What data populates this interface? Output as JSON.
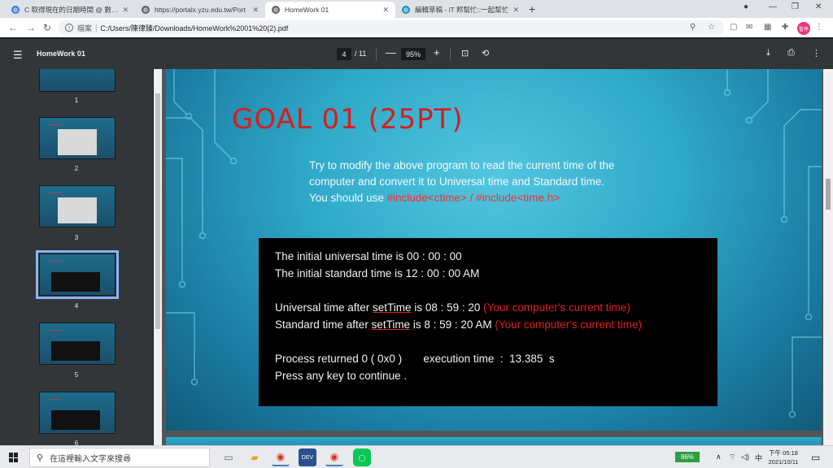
{
  "browser": {
    "tabs": [
      {
        "label": "C 取得現在的日期時間 @ 數位故",
        "fav_color": "#3b7dd8"
      },
      {
        "label": "https://portalx.yzu.edu.tw/Port",
        "fav_color": "#5f6368"
      },
      {
        "label": "HomeWork 01",
        "fav_color": "#5f6368"
      },
      {
        "label": "編輯草稿 - iT 邦幫忙::一起幫忙",
        "fav_color": "#1b8fc2"
      }
    ],
    "new_tab": "+",
    "window_controls": {
      "dropdown": "●",
      "minimize": "—",
      "maximize": "❐",
      "close": "✕"
    },
    "address": {
      "scheme": "檔案",
      "separator": "|",
      "url": "C:/Users/陳律臻/Downloads/HomeWork%2001%20(2).pdf"
    },
    "profile_label": "暫停"
  },
  "pdf_toolbar": {
    "title": "HomeWork 01",
    "page_current": "4",
    "page_total": "/ 11",
    "zoom": "95%",
    "minus": "—",
    "plus": "+"
  },
  "thumbnails": [
    {
      "number": "1"
    },
    {
      "number": "2"
    },
    {
      "number": "3"
    },
    {
      "number": "4"
    },
    {
      "number": "5"
    },
    {
      "number": "6"
    }
  ],
  "slide": {
    "title": "GOAL 01 (25PT)",
    "body": "Try to modify the above program to read the current time of the computer and convert it to Universal time and Standard time.",
    "use_prefix": "You should use ",
    "use_includes": "#include<ctime> / #include<time.h>",
    "console": {
      "line1": "The initial universal time is 00 : 00 : 00",
      "line2": "The initial standard time is 12 : 00 : 00 AM",
      "line3_prefix": "Universal time after ",
      "line3_fn": "setTime",
      "line3_value": " is 08 : 59 : 20 ",
      "line3_note": "(Your computer's current time)",
      "line4_prefix": "Standard time after ",
      "line4_fn": "setTime",
      "line4_value": " is 8 : 59 : 20 AM ",
      "line4_note": "(Your computer's current time)",
      "line5": "Process returned 0 ( 0x0 )       execution time  :  13.385  s",
      "line6": "Press any key to continue ."
    }
  },
  "taskbar": {
    "search_placeholder": "在這裡輸入文字來搜尋",
    "battery": "86%",
    "ime": "中",
    "time": "下午 05:18",
    "date": "2021/10/11"
  }
}
